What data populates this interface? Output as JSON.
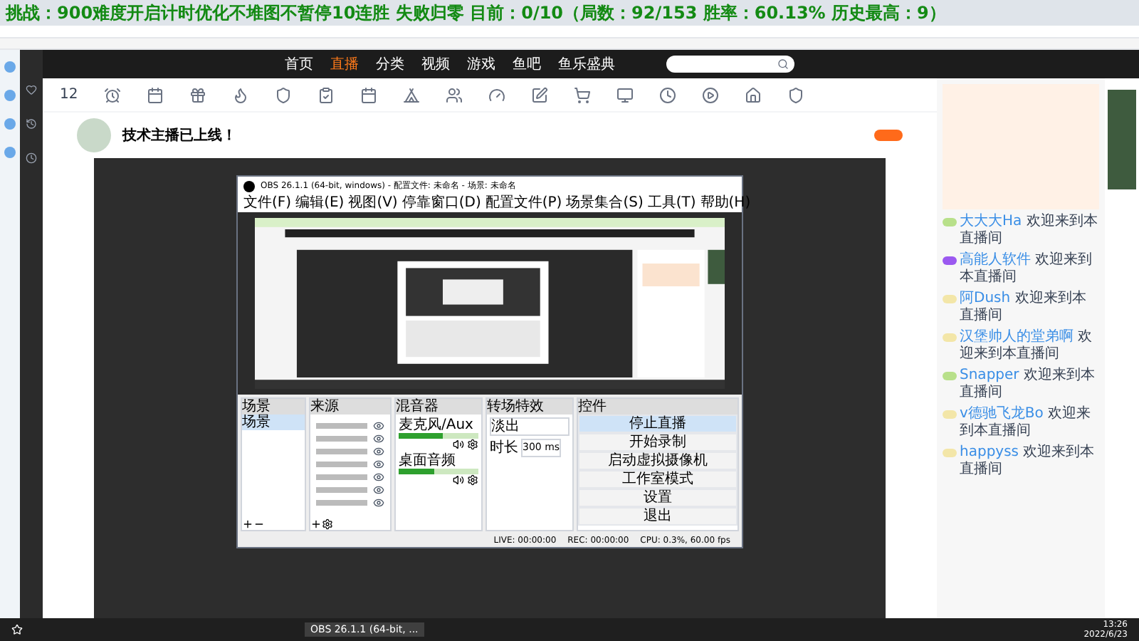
{
  "overlay": {
    "prefix": "挑战：",
    "text": "900难度开启计时优化不堆图不暂停10连胜 失败归零 目前：0/10（局数：92/153 胜率：60.13% 历史最高：9）"
  },
  "nav": [
    {
      "label": "首页",
      "selected": false
    },
    {
      "label": "直播",
      "selected": true
    },
    {
      "label": "分类",
      "selected": false
    },
    {
      "label": "视频",
      "selected": false
    },
    {
      "label": "游戏",
      "selected": false
    },
    {
      "label": "鱼吧",
      "selected": false
    },
    {
      "label": "鱼乐盛典",
      "selected": false
    }
  ],
  "stream": {
    "title": "技术主播已上线！",
    "follow_count": "12"
  },
  "obs": {
    "title": "OBS 26.1.1 (64-bit, windows) - 配置文件: 未命名 - 场景: 未命名",
    "menu": [
      "文件(F)",
      "编辑(E)",
      "视图(V)",
      "停靠窗口(D)",
      "配置文件(P)",
      "场景集合(S)",
      "工具(T)",
      "帮助(H)"
    ],
    "docks": [
      "场景",
      "来源",
      "混音器",
      "转场特效",
      "控件"
    ],
    "scenes": [
      {
        "label": "场景",
        "selected": true
      }
    ],
    "mixer": [
      {
        "name": "麦克风/Aux",
        "level": 0.55
      },
      {
        "name": "桌面音频",
        "level": 0.45
      }
    ],
    "transition": "淡出",
    "duration_label": "时长",
    "duration": "300 ms",
    "controls": [
      {
        "label": "停止直播",
        "selected": true
      },
      {
        "label": "开始录制",
        "selected": false
      },
      {
        "label": "启动虚拟摄像机",
        "selected": false
      },
      {
        "label": "工作室模式",
        "selected": false
      },
      {
        "label": "设置",
        "selected": false
      },
      {
        "label": "退出",
        "selected": false
      }
    ],
    "status": [
      "LIVE: 00:00:00",
      "REC: 00:00:00",
      "CPU: 0.3%, 60.00 fps"
    ]
  },
  "chat": [
    {
      "user": "大大大Ha",
      "text": "欢迎来到本直播间",
      "color": "#b8e08a"
    },
    {
      "user": "高能人软件",
      "text": "欢迎来到本直播间",
      "color": "#9b59f0"
    },
    {
      "user": "阿Dush",
      "text": "欢迎来到本直播间",
      "color": "#f3e6a8"
    },
    {
      "user": "汉堡帅人的堂弟啊",
      "text": "欢迎来到本直播间",
      "color": "#f3e6a8"
    },
    {
      "user": "Snapper",
      "text": "欢迎来到本直播间",
      "color": "#b8e08a"
    },
    {
      "user": "v德驰飞龙Bo",
      "text": "欢迎来到本直播间",
      "color": "#f3e6a8"
    },
    {
      "user": "happyss",
      "text": "欢迎来到本直播间",
      "color": "#f3e6a8"
    }
  ],
  "taskbar": [
    {
      "label": "OBS 26.1.1 (64-bit, ...",
      "selected": true
    }
  ],
  "clock": {
    "time": "13:26",
    "date": "2022/6/23"
  }
}
